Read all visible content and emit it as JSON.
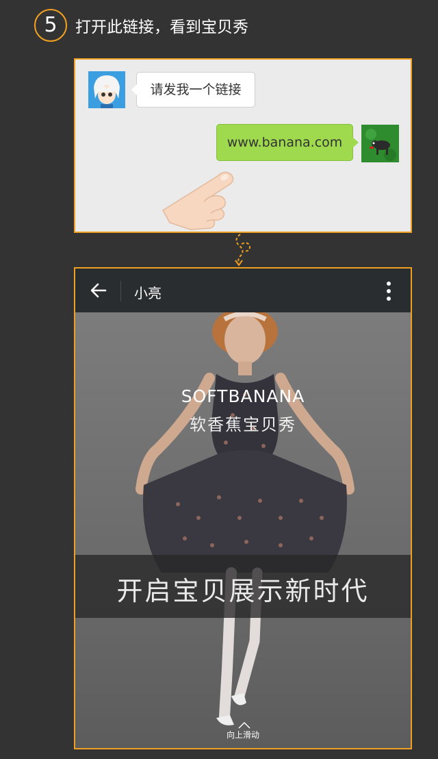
{
  "step": {
    "number": "5",
    "title": "打开此链接，看到宝贝秀"
  },
  "chat": {
    "incoming_message": "请发我一个链接",
    "outgoing_message": "www.banana.com"
  },
  "phone": {
    "contact_name": "小亮",
    "brand_title": "SOFTBANANA",
    "brand_subtitle": "软香蕉宝贝秀",
    "tagline": "开启宝贝展示新时代",
    "swipe_hint": "向上滑动"
  },
  "colors": {
    "accent": "#f0a020",
    "background": "#333333",
    "bubble_green": "#9ed94e",
    "header_dark": "#2a2d30"
  }
}
